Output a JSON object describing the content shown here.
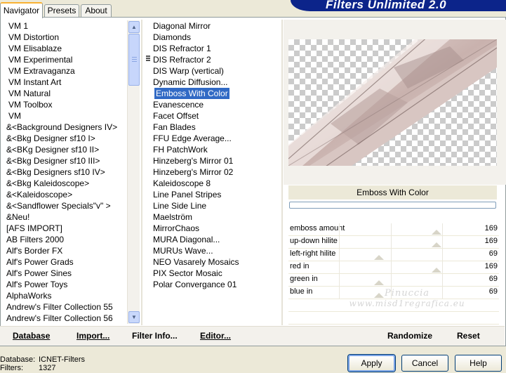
{
  "app": {
    "banner": "Filters Unlimited 2.0"
  },
  "tabs": [
    "Navigator",
    "Presets",
    "About"
  ],
  "categories": [
    "VM 1",
    "VM Distortion",
    "VM Elisablaze",
    "VM Experimental",
    "VM Extravaganza",
    "VM Instant Art",
    "VM Natural",
    "VM Toolbox",
    "VM",
    "&<Background Designers IV>",
    "&<Bkg Designer sf10 I>",
    "&<BKg Designer sf10 II>",
    "&<Bkg Designer sf10 III>",
    "&<Bkg Designers sf10 IV>",
    "&<Bkg Kaleidoscope>",
    "&<Kaleidoscope>",
    "&<Sandflower Specials\"v\" >",
    "&Neu!",
    "[AFS IMPORT]",
    "AB Filters 2000",
    "Alf's Border FX",
    "Alf's Power Grads",
    "Alf's Power Sines",
    "Alf's Power Toys",
    "AlphaWorks",
    "Andrew's Filter Collection 55",
    "Andrew's Filter Collection 56"
  ],
  "filters": [
    "Diagonal Mirror",
    "Diamonds",
    "DIS Refractor 1",
    "DIS Refractor 2",
    "DIS Warp (vertical)",
    "Dynamic Diffusion...",
    "Emboss With Color",
    "Evanescence",
    "Facet Offset",
    "Fan Blades",
    "FFU Edge Average...",
    "FH PatchWork",
    "Hinzeberg's Mirror 01",
    "Hinzeberg's Mirror 02",
    "Kaleidoscope 8",
    "Line Panel Stripes",
    "Line Side Line",
    "Maelström",
    "MirrorChaos",
    "MURA Diagonal...",
    "MURUs Wave...",
    "NEO Vasarely Mosaics",
    "PIX Sector Mosaic",
    "Polar Convergance 01"
  ],
  "selected_filter": "Emboss With Color",
  "params": [
    {
      "label": "emboss amount",
      "value": 169,
      "level": 0.66
    },
    {
      "label": "up-down hilite",
      "value": 169,
      "level": 0.66
    },
    {
      "label": "left-right hilite",
      "value": 69,
      "level": 0.27
    },
    {
      "label": "red in",
      "value": 169,
      "level": 0.66
    },
    {
      "label": "green in",
      "value": 69,
      "level": 0.27
    },
    {
      "label": "blue in",
      "value": 69,
      "level": 0.27
    }
  ],
  "watermark": {
    "line1": "Pinuccia",
    "line2": "www.misd1regrafica.eu"
  },
  "panel_buttons": {
    "database": "Database",
    "import": "Import...",
    "filter_info": "Filter Info...",
    "editor": "Editor...",
    "randomize": "Randomize",
    "reset": "Reset"
  },
  "footer": {
    "database_label": "Database:",
    "database_value": "ICNET-Filters",
    "filters_label": "Filters:",
    "filters_value": "1327"
  },
  "dialog_buttons": {
    "apply": "Apply",
    "cancel": "Cancel",
    "help": "Help"
  },
  "colors": {
    "banner": "#0c248a",
    "selection": "#316ac5",
    "tab_accent": "#f9b233"
  }
}
